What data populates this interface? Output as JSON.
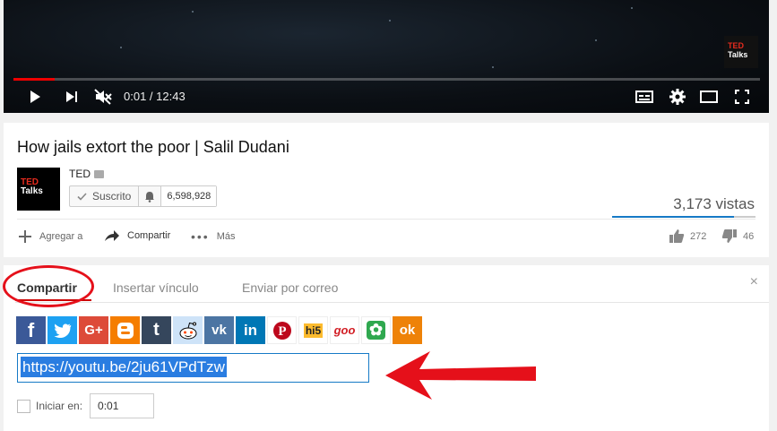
{
  "player": {
    "time": "0:01 / 12:43",
    "progress_fraction": 0.055,
    "badge_line1": "TED",
    "badge_line2": "Talks",
    "controls": [
      "play-icon",
      "next-icon",
      "mute-icon",
      "subtitles-icon",
      "settings-icon",
      "theater-icon",
      "fullscreen-icon"
    ]
  },
  "video": {
    "title": "How jails extort the poor | Salil Dudani",
    "channel": {
      "name": "TED",
      "avatar_line1": "TED",
      "avatar_line2": "Talks",
      "subscribed_label": "Suscrito",
      "subscriber_count": "6,598,928"
    },
    "views": "3,173 vistas",
    "views_bar_fraction": 0.85,
    "actions": {
      "add_to": "Agregar a",
      "share": "Compartir",
      "more": "Más"
    },
    "likes": "272",
    "dislikes": "46"
  },
  "share_panel": {
    "tabs": [
      "Compartir",
      "Insertar vínculo",
      "Enviar por correo"
    ],
    "active_tab": 0,
    "close": "×",
    "services": [
      {
        "name": "facebook",
        "glyph": "f",
        "color": "#3b5998"
      },
      {
        "name": "twitter",
        "glyph": "t",
        "color": "#1da1f2"
      },
      {
        "name": "google-plus",
        "glyph": "G+",
        "color": "#dd4b39"
      },
      {
        "name": "blogger",
        "glyph": "B",
        "color": "#f57d00"
      },
      {
        "name": "tumblr",
        "glyph": "t",
        "color": "#35465c"
      },
      {
        "name": "reddit",
        "glyph": "r",
        "color": "#cee3f8"
      },
      {
        "name": "vk",
        "glyph": "vk",
        "color": "#4c75a3"
      },
      {
        "name": "linkedin",
        "glyph": "in",
        "color": "#0077b5"
      },
      {
        "name": "pinterest",
        "glyph": "P",
        "color": "#ffffff"
      },
      {
        "name": "hi5",
        "glyph": "hi5",
        "color": "#ffffff"
      },
      {
        "name": "goo",
        "glyph": "goo",
        "color": "#ffffff"
      },
      {
        "name": "mixi",
        "glyph": "✿",
        "color": "#ffffff"
      },
      {
        "name": "odnoklassniki",
        "glyph": "ok",
        "color": "#ee8208"
      }
    ],
    "url": "https://youtu.be/2ju61VPdTzw",
    "start_label": "Iniciar en:",
    "start_value": "0:01"
  },
  "annotation": {
    "ring_color": "#e5101a",
    "arrow_color": "#e5101a"
  }
}
